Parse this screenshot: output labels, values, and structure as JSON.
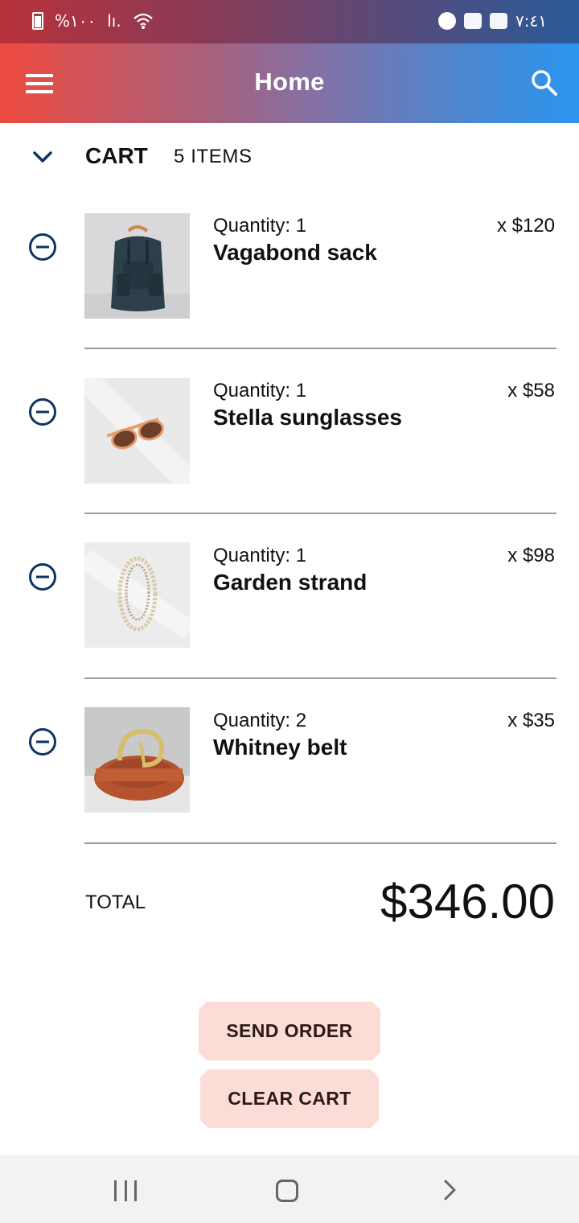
{
  "status_bar": {
    "battery_text": "%١٠٠",
    "signal_text": "lı.",
    "time": "٧:٤١"
  },
  "app_bar": {
    "title": "Home",
    "menu_icon": "menu-icon",
    "search_icon": "search-icon"
  },
  "cart": {
    "title": "CART",
    "count_label": "5 ITEMS",
    "items": [
      {
        "quantity_label": "Quantity: 1",
        "name": "Vagabond sack",
        "price": "x $120",
        "image": "backpack"
      },
      {
        "quantity_label": "Quantity: 1",
        "name": "Stella sunglasses",
        "price": "x $58",
        "image": "sunglasses"
      },
      {
        "quantity_label": "Quantity: 1",
        "name": "Garden strand",
        "price": "x $98",
        "image": "necklace"
      },
      {
        "quantity_label": "Quantity: 2",
        "name": "Whitney belt",
        "price": "x $35",
        "image": "belt"
      }
    ],
    "total_label": "TOTAL",
    "total_value": "$346.00"
  },
  "actions": {
    "send_order": "SEND ORDER",
    "clear_cart": "CLEAR CART"
  },
  "colors": {
    "accent_dark": "#0d3461",
    "button_bg": "#fcdcd6"
  }
}
